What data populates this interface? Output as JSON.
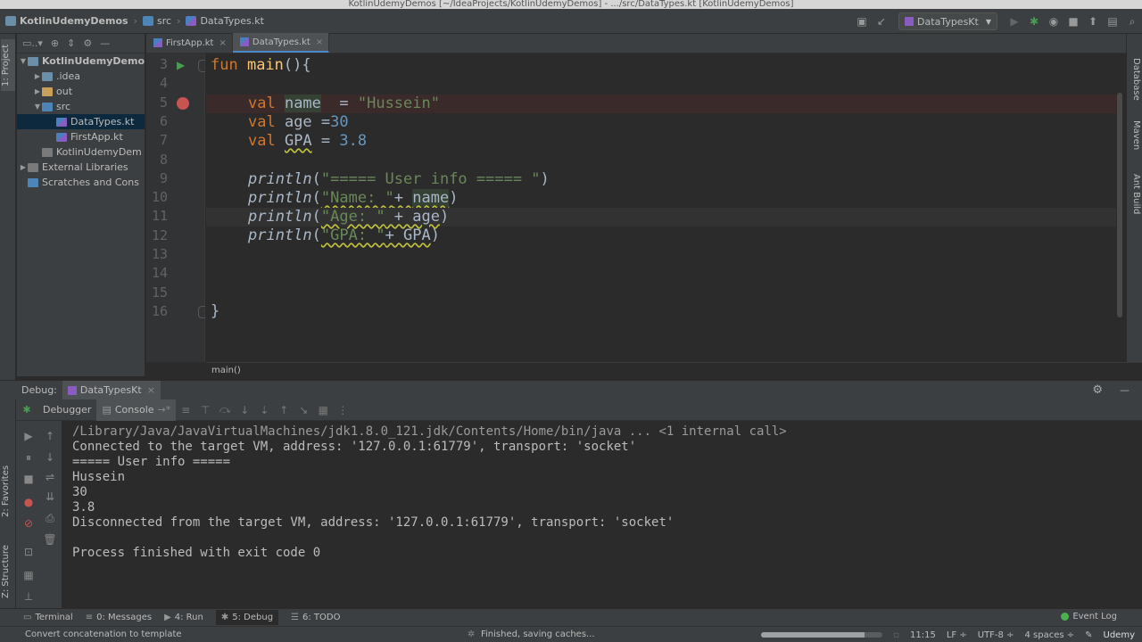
{
  "window_title": "KotlinUdemyDemos [~/IdeaProjects/KotlinUdemyDemos] - .../src/DataTypes.kt [KotlinUdemyDemos]",
  "breadcrumbs": [
    "KotlinUdemyDemos",
    "src",
    "DataTypes.kt"
  ],
  "run_config": "DataTypesKt",
  "left_strip": {
    "project": "1: Project",
    "favorites": "2: Favorites",
    "structure": "Z: Structure"
  },
  "right_strip": {
    "database": "Database",
    "maven": "Maven",
    "ant": "Ant Build"
  },
  "project_tree": [
    {
      "label": "KotlinUdemyDemo",
      "depth": 0,
      "arrow": "▼",
      "icon": "folder",
      "bold": true
    },
    {
      "label": ".idea",
      "depth": 1,
      "arrow": "▶",
      "icon": "folder"
    },
    {
      "label": "out",
      "depth": 1,
      "arrow": "▶",
      "icon": "folder-orange"
    },
    {
      "label": "src",
      "depth": 1,
      "arrow": "▼",
      "icon": "folder-blue"
    },
    {
      "label": "DataTypes.kt",
      "depth": 2,
      "arrow": "",
      "icon": "kotlin-file",
      "selected": true
    },
    {
      "label": "FirstApp.kt",
      "depth": 2,
      "arrow": "",
      "icon": "kotlin-file"
    },
    {
      "label": "KotlinUdemyDem",
      "depth": 1,
      "arrow": "",
      "icon": "module-file"
    },
    {
      "label": "External Libraries",
      "depth": 0,
      "arrow": "▶",
      "icon": "library"
    },
    {
      "label": "Scratches and Cons",
      "depth": 0,
      "arrow": "",
      "icon": "scratch"
    }
  ],
  "editor_tabs": [
    {
      "label": "FirstApp.kt",
      "active": false
    },
    {
      "label": "DataTypes.kt",
      "active": true
    }
  ],
  "line_numbers": [
    "3",
    "4",
    "5",
    "6",
    "7",
    "8",
    "9",
    "10",
    "11",
    "12",
    "13",
    "14",
    "15",
    "16"
  ],
  "code": {
    "l3": {
      "kw": "fun ",
      "fn": "main",
      "rest": "(){"
    },
    "l5": {
      "kw": "val ",
      "name": "name",
      "mid": "  = ",
      "str": "\"Hussein\""
    },
    "l6": {
      "kw": "val ",
      "name": "age",
      "mid": " =",
      "num": "30"
    },
    "l7": {
      "kw": "val ",
      "name": "GPA",
      "mid": " = ",
      "num": "3.8"
    },
    "l9": {
      "fn": "println",
      "open": "(",
      "str": "\"===== User info ===== \"",
      "close": ")"
    },
    "l10": {
      "fn": "println",
      "open": "(",
      "str": "\"Name: \"",
      "mid": "+ ",
      "var": "name",
      "close": ")"
    },
    "l11": {
      "fn": "println",
      "open": "(",
      "str": "\"Age: \"",
      "mid": " + age",
      "close": ")"
    },
    "l12": {
      "fn": "println",
      "open": "(",
      "str": "\"GPA: \"",
      "mid": "+ GPA",
      "close": ")"
    },
    "l16": "}"
  },
  "editor_breadcrumb": "main()",
  "debug": {
    "label": "Debug:",
    "config_tab": "DataTypesKt",
    "debugger_tab": "Debugger",
    "console_tab": "Console"
  },
  "console_lines": [
    "/Library/Java/JavaVirtualMachines/jdk1.8.0_121.jdk/Contents/Home/bin/java ... <1 internal call>",
    "Connected to the target VM, address: '127.0.0.1:61779', transport: 'socket'",
    "===== User info =====",
    "Hussein",
    "30",
    "3.8",
    "Disconnected from the target VM, address: '127.0.0.1:61779', transport: 'socket'",
    "",
    "Process finished with exit code 0"
  ],
  "bottom_tabs": [
    {
      "label": "Terminal",
      "active": false
    },
    {
      "label": "0: Messages",
      "active": false
    },
    {
      "label": "4: Run",
      "active": false
    },
    {
      "label": "5: Debug",
      "active": true
    },
    {
      "label": "6: TODO",
      "active": false
    }
  ],
  "event_log": "Event Log",
  "status": {
    "left": "Convert concatenation to template",
    "task": "Finished, saving caches...",
    "progress": 0.85,
    "position": "11:15",
    "line_sep": "LF ÷",
    "encoding": "UTF-8 ÷",
    "indent": "4 spaces ÷",
    "watermark": "Udemy"
  },
  "colors": {
    "breakpoint": "#c75450",
    "accent": "#4a88c7",
    "run": "#499c54"
  }
}
